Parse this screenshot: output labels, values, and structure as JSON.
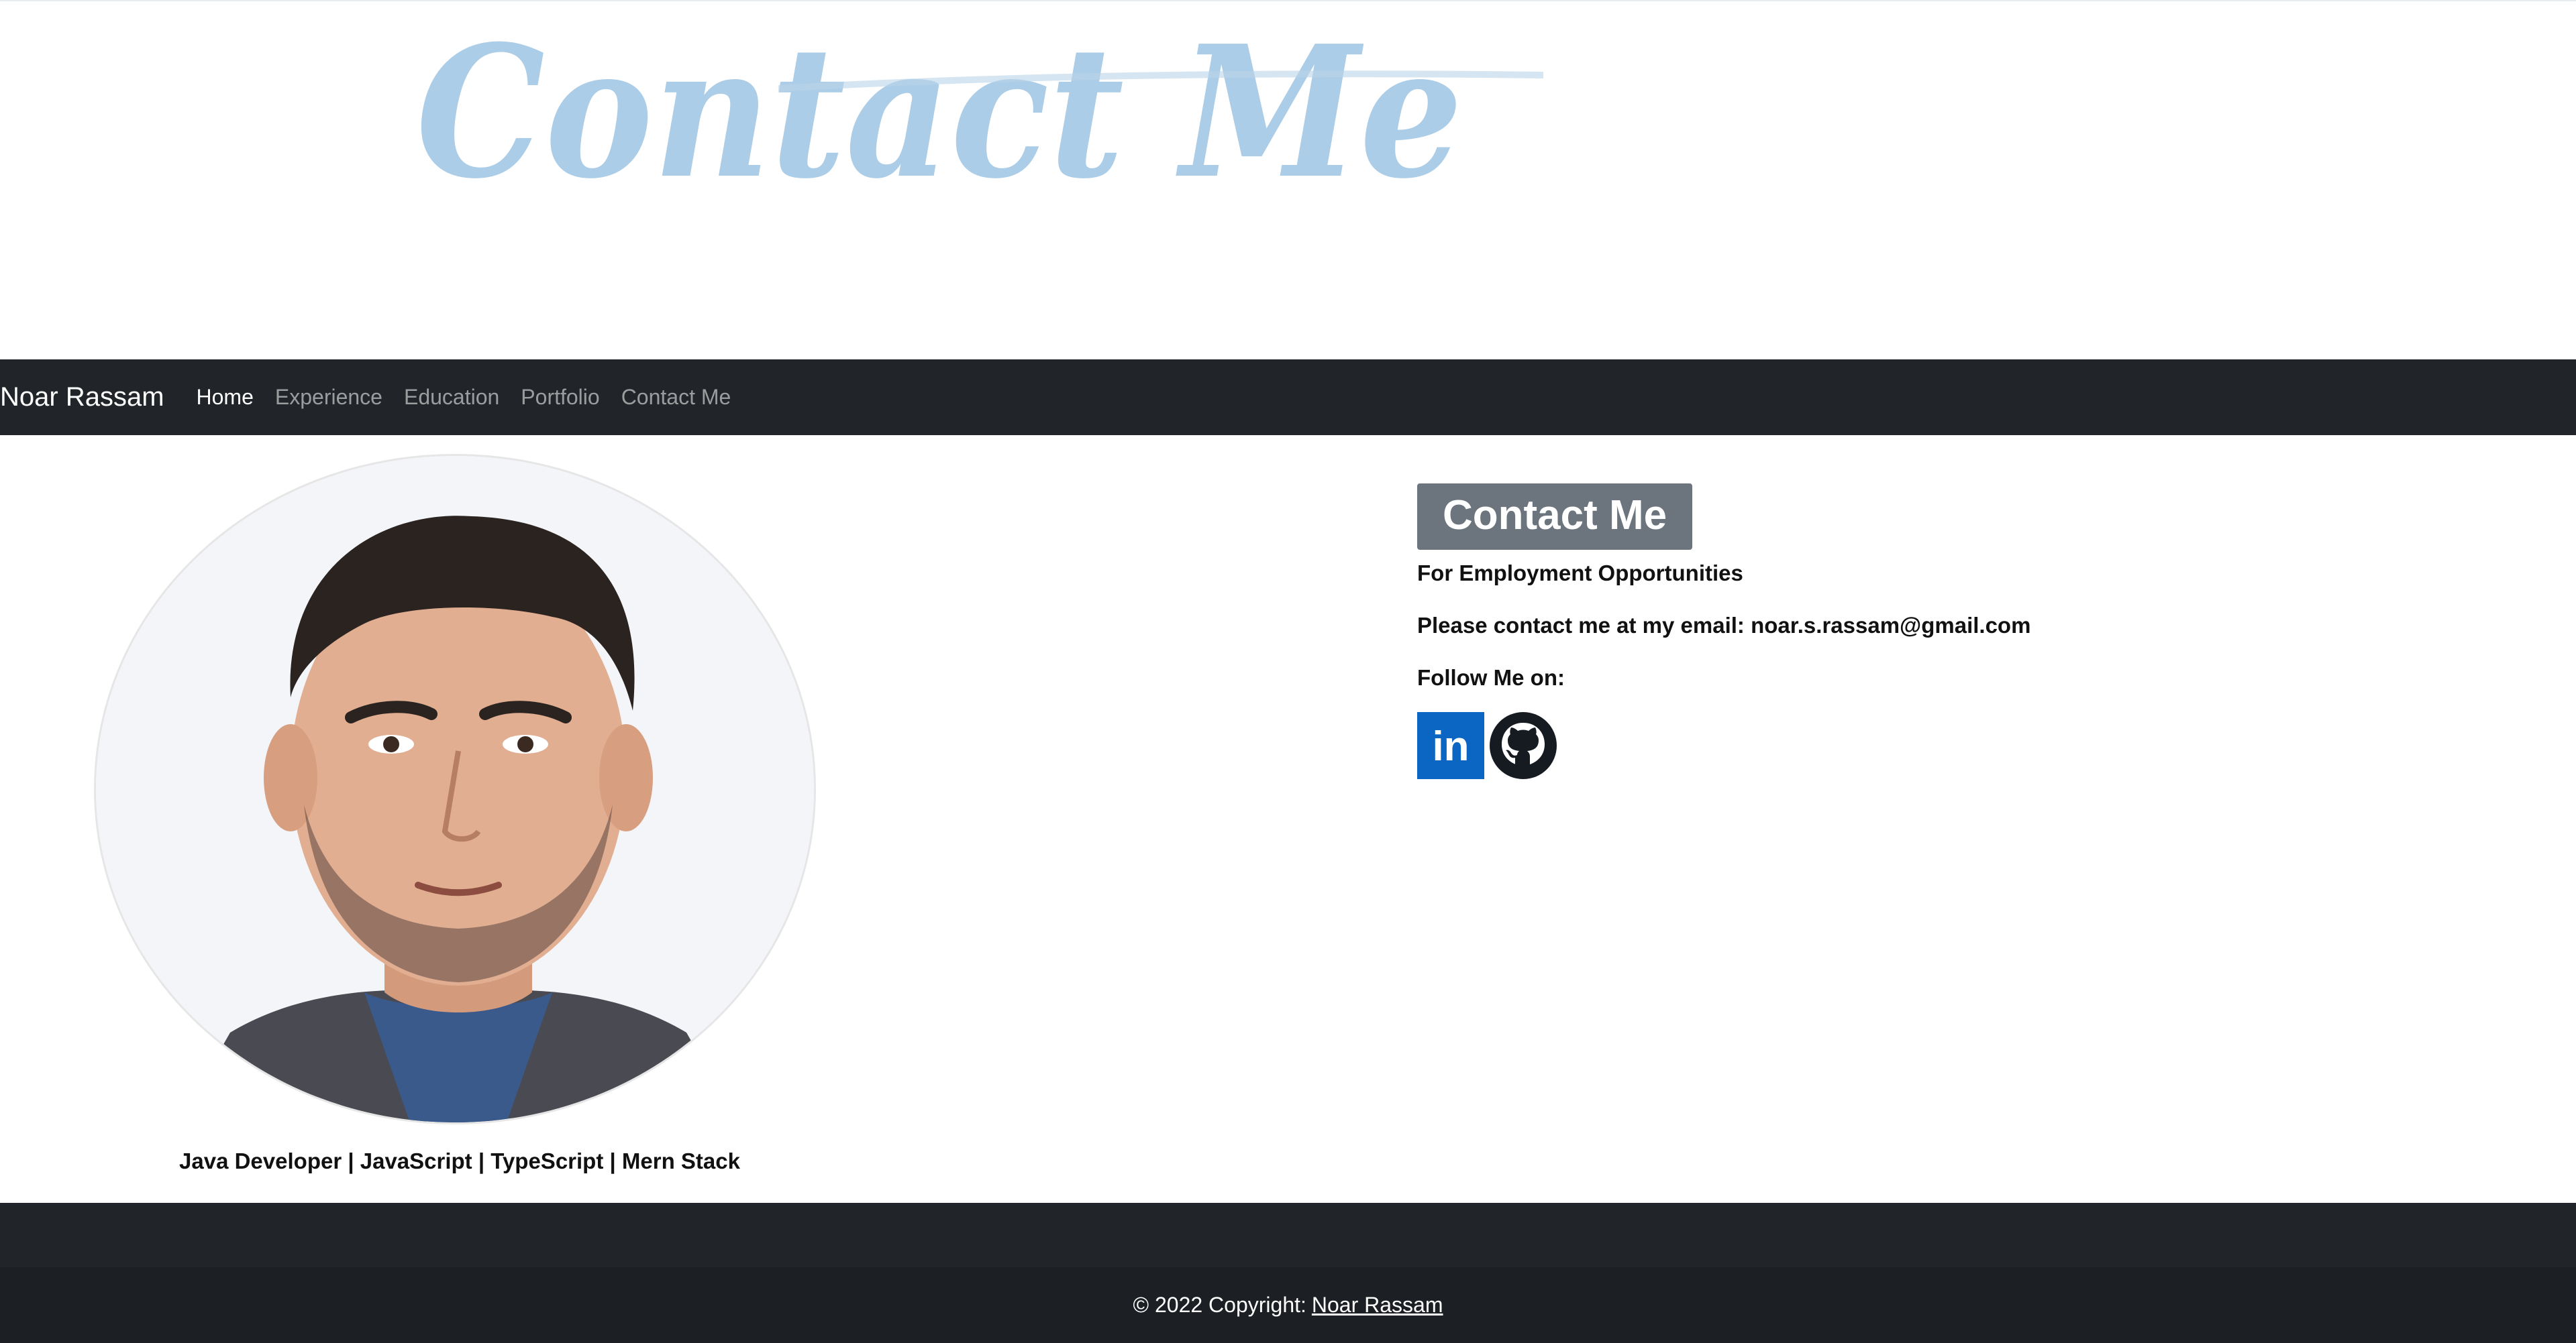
{
  "banner": {
    "text": "Contact Me",
    "colors": {
      "primary": "#9ec4e3",
      "secondary": "#cfdfee"
    }
  },
  "navbar": {
    "brand": "Noar Rassam",
    "links": [
      {
        "label": "Home",
        "active": true
      },
      {
        "label": "Experience",
        "active": false
      },
      {
        "label": "Education",
        "active": false
      },
      {
        "label": "Portfolio",
        "active": false
      },
      {
        "label": "Contact Me",
        "active": false
      }
    ],
    "background": "#212529"
  },
  "profile": {
    "tagline": "Java Developer | JavaScript | TypeScript | Mern Stack"
  },
  "contact": {
    "title": "Contact Me",
    "line1": "For Employment Opportunities",
    "line2": "Please contact me at my email: noar.s.rassam@gmail.com",
    "line3": "Follow Me on:",
    "socials": [
      {
        "name": "linkedin-icon",
        "label": "in",
        "color": "#0a66c2"
      },
      {
        "name": "github-icon",
        "color": "#161b22"
      }
    ]
  },
  "footer": {
    "text": "© 2022 Copyright:",
    "link": "Noar Rassam"
  }
}
